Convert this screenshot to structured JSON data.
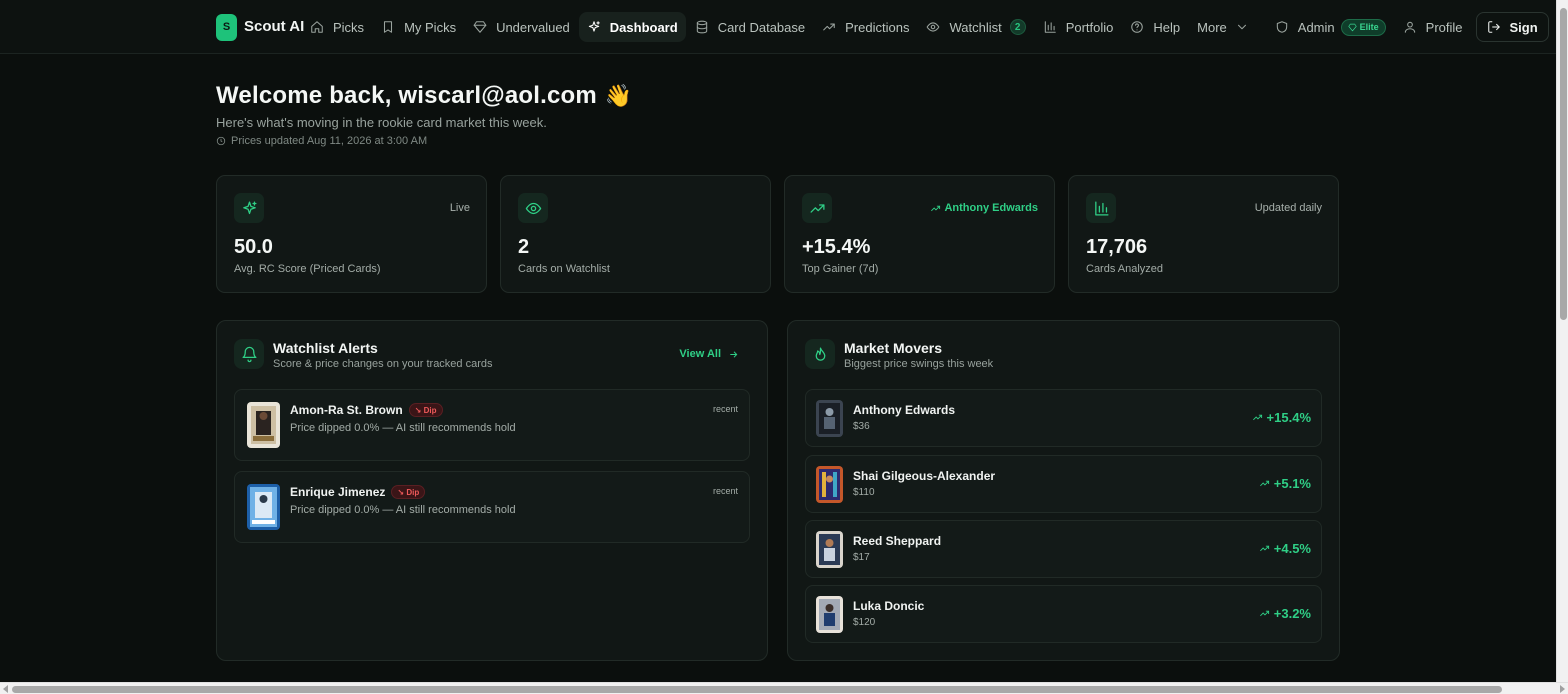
{
  "brand": {
    "badge": "S",
    "name": "Scout AI"
  },
  "nav": {
    "picks": "Picks",
    "my_picks": "My Picks",
    "undervalued": "Undervalued",
    "dashboard": "Dashboard",
    "card_database": "Card Database",
    "predictions": "Predictions",
    "watchlist": "Watchlist",
    "watchlist_count": "2",
    "portfolio": "Portfolio",
    "help": "Help",
    "more": "More",
    "admin": "Admin",
    "elite_badge": "Elite",
    "profile": "Profile",
    "sign_out": "Sign"
  },
  "header": {
    "welcome": "Welcome back, wiscarl@aol.com",
    "wave": "👋",
    "subtitle": "Here's what's moving in the rookie card market this week.",
    "updated": "Prices updated Aug 11, 2026 at 3:00 AM"
  },
  "stats": [
    {
      "tag": "Live",
      "value": "50.0",
      "label": "Avg. RC Score (Priced Cards)"
    },
    {
      "tag": "",
      "value": "2",
      "label": "Cards on Watchlist"
    },
    {
      "tag": "Anthony Edwards",
      "value": "+15.4%",
      "label": "Top Gainer (7d)"
    },
    {
      "tag": "Updated daily",
      "value": "17,706",
      "label": "Cards Analyzed"
    }
  ],
  "alerts_panel": {
    "title": "Watchlist Alerts",
    "subtitle": "Score & price changes on your tracked cards",
    "view_all": "View All",
    "items": [
      {
        "name": "Amon-Ra St. Brown",
        "badge": "Dip",
        "message": "Price dipped 0.0% — AI still recommends hold",
        "time": "recent"
      },
      {
        "name": "Enrique Jimenez",
        "badge": "Dip",
        "message": "Price dipped 0.0% — AI still recommends hold",
        "time": "recent"
      }
    ]
  },
  "movers_panel": {
    "title": "Market Movers",
    "subtitle": "Biggest price swings this week",
    "items": [
      {
        "name": "Anthony Edwards",
        "price": "$36",
        "change": "+15.4%"
      },
      {
        "name": "Shai Gilgeous-Alexander",
        "price": "$110",
        "change": "+5.1%"
      },
      {
        "name": "Reed Sheppard",
        "price": "$17",
        "change": "+4.5%"
      },
      {
        "name": "Luka Doncic",
        "price": "$120",
        "change": "+3.2%"
      }
    ]
  },
  "colors": {
    "background": "#0b0f0d",
    "accent": "#2fcf86",
    "dip": "#ee5a5a",
    "card": "#111715"
  }
}
